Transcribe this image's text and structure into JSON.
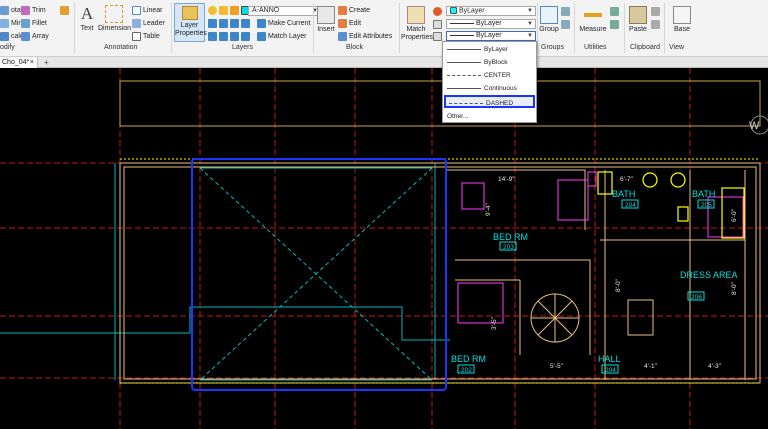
{
  "ribbon": {
    "modify": {
      "rotate": "otate",
      "trim": "Trim",
      "mirror": "Mirror",
      "fillet": "Fillet",
      "scale": "cale",
      "array": "Array",
      "title": "odify"
    },
    "annotation": {
      "text": "Text",
      "dimension": "Dimension",
      "linear": "Linear",
      "leader": "Leader",
      "table": "Table",
      "title": "Annotation"
    },
    "layers": {
      "layer_properties": "Layer\nProperties",
      "layer_name": "A-ANNO",
      "make_current": "Make Current",
      "match_layer": "Match Layer",
      "title": "Layers"
    },
    "block": {
      "insert": "Insert",
      "create": "Create",
      "edit": "Edit",
      "edit_attributes": "Edit Attributes",
      "title": "Block"
    },
    "properties": {
      "match_properties": "Match\nProperties",
      "color": "ByLayer",
      "lineweight": "ByLayer",
      "linetype": "ByLayer"
    },
    "groups": {
      "group": "Group",
      "title": "Groups"
    },
    "utilities": {
      "measure": "Measure",
      "title": "Utilities"
    },
    "clipboard": {
      "paste": "Paste",
      "title": "Clipboard"
    },
    "view": {
      "base": "Base",
      "title": "View"
    }
  },
  "tab": {
    "name": "Cho_04*",
    "add": "+",
    "close": "×"
  },
  "linetype_dropdown": {
    "items": [
      "ByLayer",
      "ByBlock",
      "CENTER",
      "Continuous",
      "DASHED"
    ],
    "selected": "DASHED",
    "other": "Other..."
  },
  "drawing": {
    "rooms": [
      {
        "name": "BED RM",
        "number": "203"
      },
      {
        "name": "BED RM",
        "number": "202"
      },
      {
        "name": "BATH",
        "number": "204"
      },
      {
        "name": "BATH",
        "number": "205"
      },
      {
        "name": "DRESS AREA",
        "number": "206"
      },
      {
        "name": "HALL",
        "number": "204"
      }
    ],
    "dimensions": [
      "14'-9\"",
      "6'-7\"",
      "9'-4\"",
      "3'-5\"",
      "4'-1\"",
      "4'-3\"",
      "5'-5\"",
      "8'-0\"",
      "6'-0\"",
      "8'-0\""
    ],
    "compass_letter": "W"
  },
  "colors": {
    "selection": "#1a35ff",
    "cyan": "#00c8c8",
    "yellow": "#ffff00",
    "red": "#d11a1a",
    "magenta": "#ff3aff",
    "wall": "#e5c07b"
  }
}
